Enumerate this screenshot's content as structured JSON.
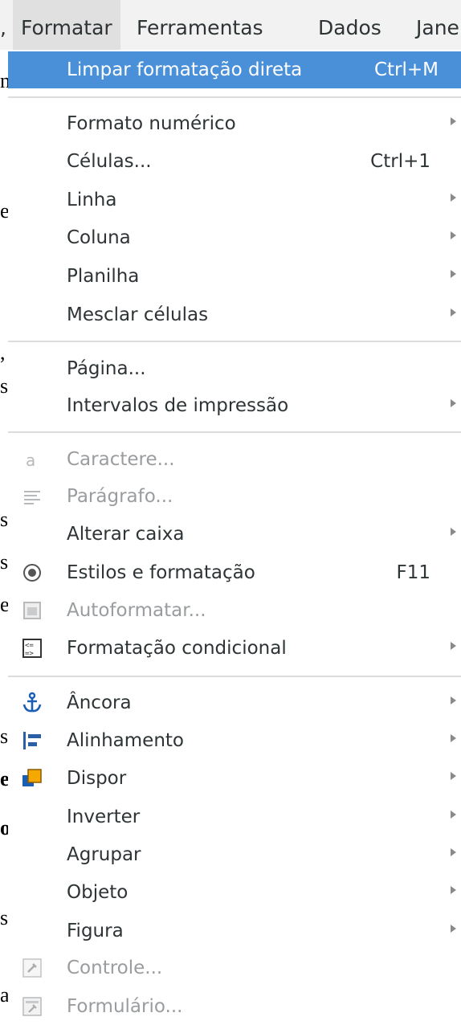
{
  "menubar": {
    "prev_fragment": ",",
    "items": [
      {
        "label": "Formatar"
      },
      {
        "label": "Ferramentas"
      },
      {
        "label": "Dados"
      },
      {
        "label": "Jane"
      }
    ]
  },
  "document_fragments": [
    "n",
    "e",
    ",",
    "s",
    "s",
    "s",
    "e",
    "s",
    "e",
    "o",
    "s",
    "a"
  ],
  "menu": {
    "items": [
      {
        "label": "Limpar formatação direta",
        "accel": "Ctrl+M"
      },
      {
        "label": "Formato numérico"
      },
      {
        "label": "Células...",
        "accel": "Ctrl+1"
      },
      {
        "label": "Linha"
      },
      {
        "label": "Coluna"
      },
      {
        "label": "Planilha"
      },
      {
        "label": "Mesclar células"
      },
      {
        "label": "Página..."
      },
      {
        "label": "Intervalos de impressão"
      },
      {
        "label": "Caractere...",
        "icon": "character-icon"
      },
      {
        "label": "Parágrafo...",
        "icon": "paragraph-icon"
      },
      {
        "label": "Alterar caixa"
      },
      {
        "label": "Estilos e formatação",
        "accel": "F11",
        "icon": "styles-icon"
      },
      {
        "label": "Autoformatar...",
        "icon": "autoformat-icon"
      },
      {
        "label": "Formatação condicional",
        "icon": "conditional-format-icon"
      },
      {
        "label": "Âncora",
        "icon": "anchor-icon"
      },
      {
        "label": "Alinhamento",
        "icon": "align-icon"
      },
      {
        "label": "Dispor",
        "icon": "arrange-icon"
      },
      {
        "label": "Inverter"
      },
      {
        "label": "Agrupar"
      },
      {
        "label": "Objeto"
      },
      {
        "label": "Figura"
      },
      {
        "label": "Controle...",
        "icon": "control-icon"
      },
      {
        "label": "Formulário...",
        "icon": "form-icon"
      }
    ]
  },
  "colors": {
    "highlight": "#4a90d9",
    "anchor": "#1a5fb4",
    "arrange": "#f5a800"
  }
}
